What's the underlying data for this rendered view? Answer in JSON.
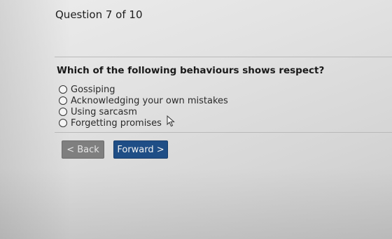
{
  "quiz": {
    "counter": "Question 7 of 10",
    "question": "Which of the following behaviours shows respect?",
    "options": [
      "Gossiping",
      "Acknowledging your own mistakes",
      "Using sarcasm",
      "Forgetting promises"
    ],
    "selected_index": null
  },
  "nav": {
    "back_label": "< Back",
    "forward_label": "Forward >"
  },
  "colors": {
    "forward_button": "#1f4e86",
    "back_button": "#7f7f7f"
  },
  "icons": {
    "pointer": "mouse-pointer-icon"
  }
}
